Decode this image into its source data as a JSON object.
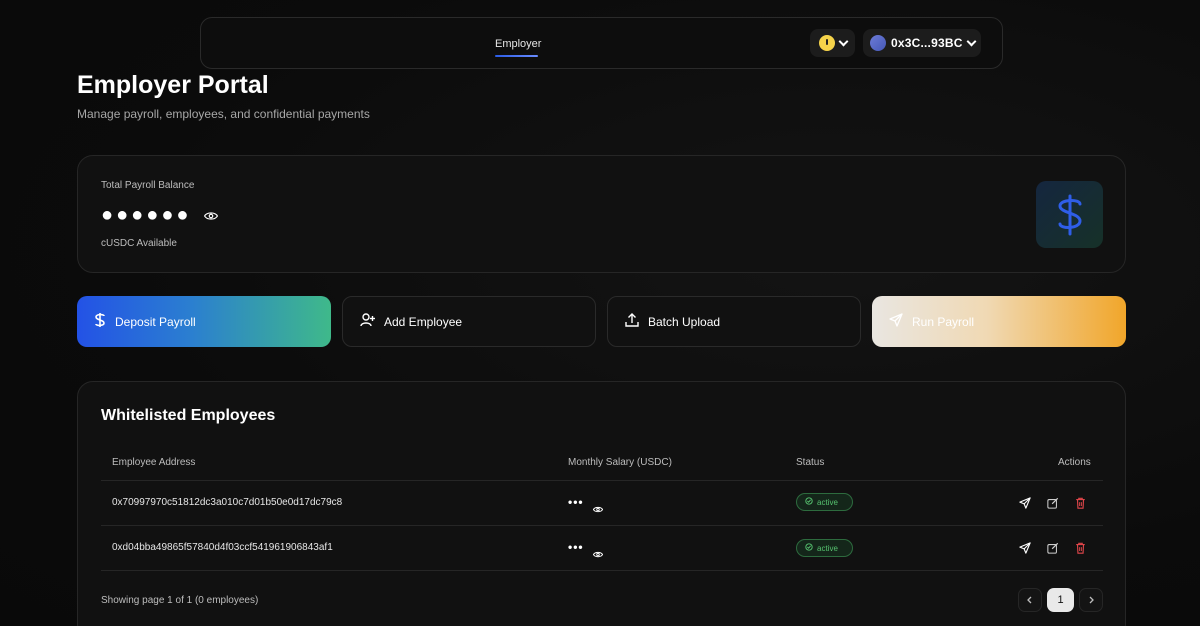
{
  "nav": {
    "link": "Employer",
    "wallet_address": "0x3C...93BC"
  },
  "header": {
    "title": "Employer Portal",
    "subtitle": "Manage payroll, employees, and confidential payments"
  },
  "balance": {
    "label": "Total Payroll Balance",
    "masked": "●●●●●●",
    "currency": "cUSDC Available"
  },
  "actions": {
    "deposit": "Deposit Payroll",
    "add": "Add Employee",
    "batch": "Batch Upload",
    "run": "Run Payroll"
  },
  "employees": {
    "title": "Whitelisted Employees",
    "columns": {
      "address": "Employee Address",
      "salary": "Monthly Salary (USDC)",
      "status": "Status",
      "actions": "Actions"
    },
    "rows": [
      {
        "address": "0x70997970c51812dc3a010c7d01b50e0d17dc79c8",
        "salary": "•••",
        "status": "active"
      },
      {
        "address": "0xd04bba49865f57840d4f03ccf541961906843af1",
        "salary": "•••",
        "status": "active"
      }
    ],
    "pagination": {
      "summary": "Showing page 1 of 1 (0 employees)",
      "current": "1"
    }
  },
  "colors": {
    "accent_blue": "#2352e6",
    "accent_green": "#3fb98a",
    "accent_orange": "#f1a62a",
    "status_green": "#56c26f",
    "delete_red": "#e0464a"
  }
}
